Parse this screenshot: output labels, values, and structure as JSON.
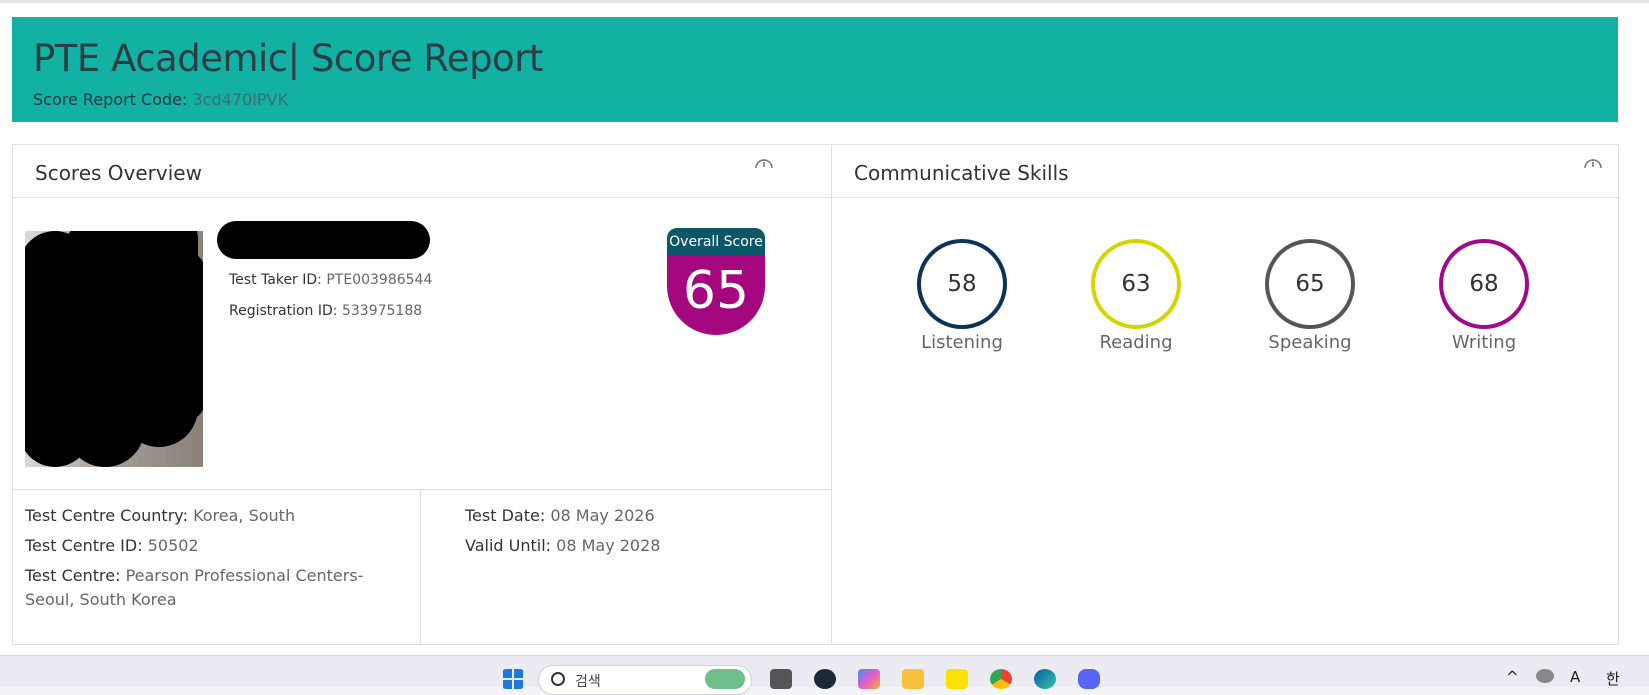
{
  "header": {
    "title": "PTE Academic| Score Report",
    "code_label": "Score Report Code:",
    "code_value": "3cd470IPVK"
  },
  "scores_overview": {
    "title": "Scores Overview",
    "test_taker_id_label": "Test Taker ID",
    "test_taker_id_value": "PTE003986544",
    "registration_id_label": "Registration ID",
    "registration_id_value": "533975188",
    "overall_label": "Overall Score",
    "overall_value": "65",
    "test_centre_country_label": "Test Centre Country",
    "test_centre_country_value": "Korea, South",
    "test_centre_id_label": "Test Centre ID",
    "test_centre_id_value": "50502",
    "test_centre_label": "Test Centre",
    "test_centre_value": "Pearson Professional Centers-Seoul, South Korea",
    "test_date_label": "Test Date",
    "test_date_value": "08 May 2026",
    "valid_until_label": "Valid Until",
    "valid_until_value": "08 May 2028"
  },
  "communicative_skills": {
    "title": "Communicative Skills",
    "skills": [
      {
        "name": "Listening",
        "score": "58",
        "color": "#0b3158"
      },
      {
        "name": "Reading",
        "score": "63",
        "color": "#d2d700"
      },
      {
        "name": "Speaking",
        "score": "65",
        "color": "#555555"
      },
      {
        "name": "Writing",
        "score": "68",
        "color": "#a0098a"
      }
    ]
  },
  "taskbar": {
    "search_placeholder": "검색",
    "tray_ime_a": "A",
    "tray_ime_han": "한",
    "icons": [
      "windows-start-icon",
      "search-icon",
      "widgets-icon",
      "task-view-icon",
      "steam-icon",
      "copilot-icon",
      "file-explorer-icon",
      "kakaotalk-icon",
      "chrome-icon",
      "edge-icon",
      "discord-icon"
    ]
  },
  "colors": {
    "header_bg": "#13b1a4",
    "overall_band": "#0b5768",
    "overall_shield": "#a5087e"
  }
}
